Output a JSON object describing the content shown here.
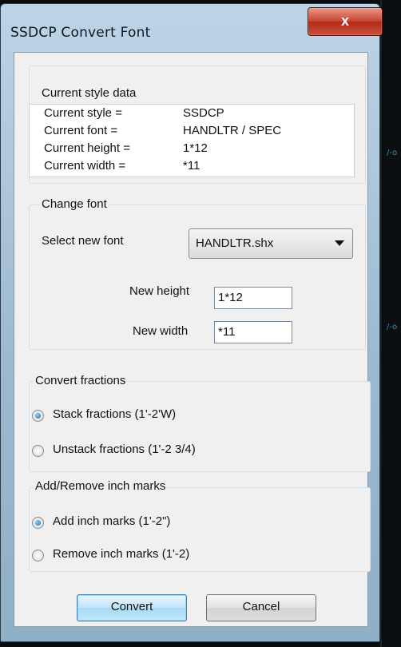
{
  "window": {
    "title": "SSDCP Convert Font",
    "close_label": "x"
  },
  "current_style": {
    "group_label": "Current style data",
    "rows": [
      {
        "label": "Current style =",
        "value": "SSDCP"
      },
      {
        "label": "Current font =",
        "value": "HANDLTR / SPEC"
      },
      {
        "label": "Current height =",
        "value": "1*12"
      },
      {
        "label": "Current width =",
        "value": "*11"
      }
    ]
  },
  "change_font": {
    "group_label": "Change font",
    "select_label": "Select new font",
    "selected_font": "HANDLTR.shx",
    "height_label": "New height",
    "height_value": "1*12",
    "width_label": "New width",
    "width_value": "*11"
  },
  "convert_fractions": {
    "group_label": "Convert fractions",
    "options": [
      {
        "label": "Stack fractions (1'-2'W)",
        "selected": true
      },
      {
        "label": "Unstack fractions (1'-2 3/4)",
        "selected": false
      }
    ]
  },
  "inch_marks": {
    "group_label": "Add/Remove inch marks",
    "options": [
      {
        "label": "Add inch marks (1'-2\")",
        "selected": true
      },
      {
        "label": "Remove inch marks (1'-2)",
        "selected": false
      }
    ]
  },
  "buttons": {
    "convert": "Convert",
    "cancel": "Cancel"
  },
  "icons": {
    "close": "close-icon",
    "dropdown": "chevron-down-icon",
    "radio": "radio-icon"
  },
  "colors": {
    "title_bar": "#9bb8cf",
    "close_button": "#c94532",
    "dialog_bg": "#f0f0f0"
  }
}
